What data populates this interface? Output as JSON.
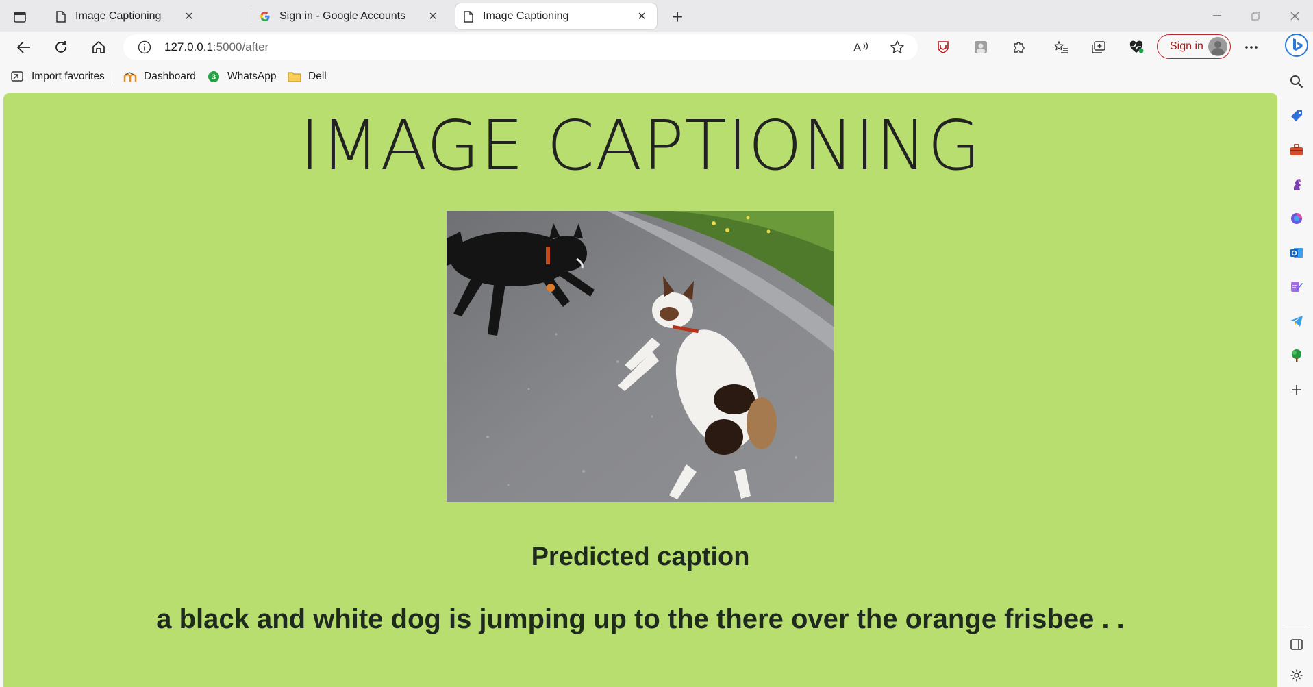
{
  "browser": {
    "tabs": [
      {
        "title": "Image Captioning",
        "icon": "page-icon",
        "active": false
      },
      {
        "title": "Sign in - Google Accounts",
        "icon": "google-g-icon",
        "active": false
      },
      {
        "title": "Image Captioning",
        "icon": "page-icon",
        "active": true
      }
    ],
    "address": {
      "host": "127.0.0.1",
      "path": ":5000/after"
    },
    "sign_in_label": "Sign in",
    "favorites": [
      {
        "label": "Import favorites",
        "icon": "import-favorites-icon"
      },
      {
        "label": "Dashboard",
        "icon": "moodle-icon"
      },
      {
        "label": "WhatsApp",
        "icon": "whatsapp-icon",
        "badge": "3"
      },
      {
        "label": "Dell",
        "icon": "folder-icon"
      }
    ]
  },
  "page": {
    "title": "IMAGE CAPTIONING",
    "image_alt": "two dogs playing on a road",
    "caption_heading": "Predicted caption",
    "caption": "a black and white dog is jumping up to the there over the orange frisbee . ."
  },
  "colors": {
    "page_background": "#b8de6f",
    "signin_border": "#c0242c",
    "tab_strip": "#e9e9ec"
  }
}
